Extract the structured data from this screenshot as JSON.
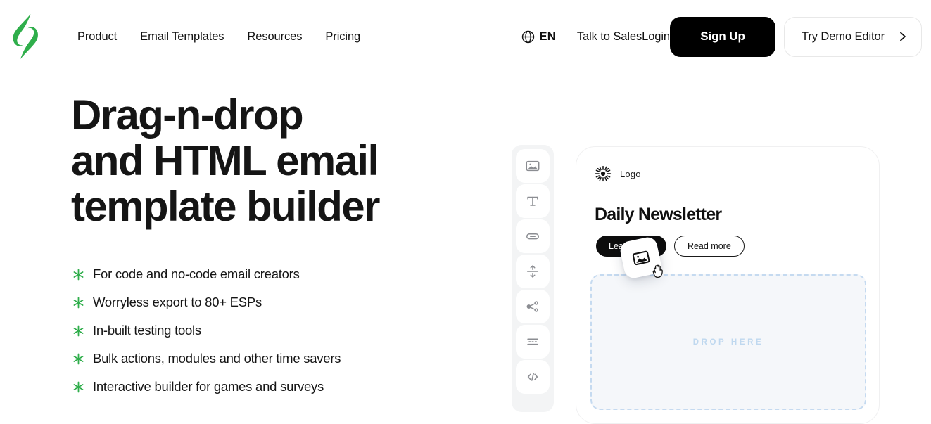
{
  "brand": {
    "logo_icon": "stripo-leaf-logo",
    "green": "#2fae4b",
    "black": "#000000"
  },
  "header": {
    "nav_items": [
      {
        "label": "Product",
        "name": "nav-link-product"
      },
      {
        "label": "Email Templates",
        "name": "nav-link-email-templates"
      },
      {
        "label": "Resources",
        "name": "nav-link-resources"
      },
      {
        "label": "Pricing",
        "name": "nav-link-pricing"
      }
    ],
    "language": {
      "icon": "globe-icon",
      "label": "EN"
    },
    "talk_to_sales": "Talk to Sales",
    "login": "Login",
    "sign_up": "Sign Up",
    "try_demo_editor": "Try Demo Editor",
    "try_demo_chevron_icon": "chevron-right-icon"
  },
  "hero": {
    "title_line_1": "Drag-n-drop",
    "title_line_2": "and HTML email",
    "title_line_3": "template builder",
    "bullet_icon": "asterisk-icon",
    "features": [
      "For code and no-code email creators",
      "Worryless export to 80+ ESPs",
      "In-built testing tools",
      "Bulk actions, modules and other time savers",
      "Interactive builder for games and surveys"
    ]
  },
  "toolbar": {
    "tools": [
      {
        "name": "image-block-tool",
        "icon": "image-icon"
      },
      {
        "name": "text-block-tool",
        "icon": "text-t-icon"
      },
      {
        "name": "button-block-tool",
        "icon": "button-icon"
      },
      {
        "name": "spacer-block-tool",
        "icon": "spacer-arrows-icon"
      },
      {
        "name": "social-block-tool",
        "icon": "share-nodes-icon"
      },
      {
        "name": "video-block-tool",
        "icon": "video-divider-icon"
      },
      {
        "name": "html-block-tool",
        "icon": "code-brackets-icon"
      }
    ]
  },
  "email_preview": {
    "logo_icon": "sunburst-logo-icon",
    "logo_text": "Logo",
    "heading": "Daily Newsletter",
    "primary_button": "Learn more",
    "secondary_button": "Read more",
    "dropzone_label": "DROP HERE",
    "dropzone_border_color": "#c5daf0",
    "dropzone_text_color": "#bfd8ef"
  },
  "drag_state": {
    "dragged_tile_icon": "image-icon",
    "cursor_icon": "grabbing-hand-cursor"
  }
}
